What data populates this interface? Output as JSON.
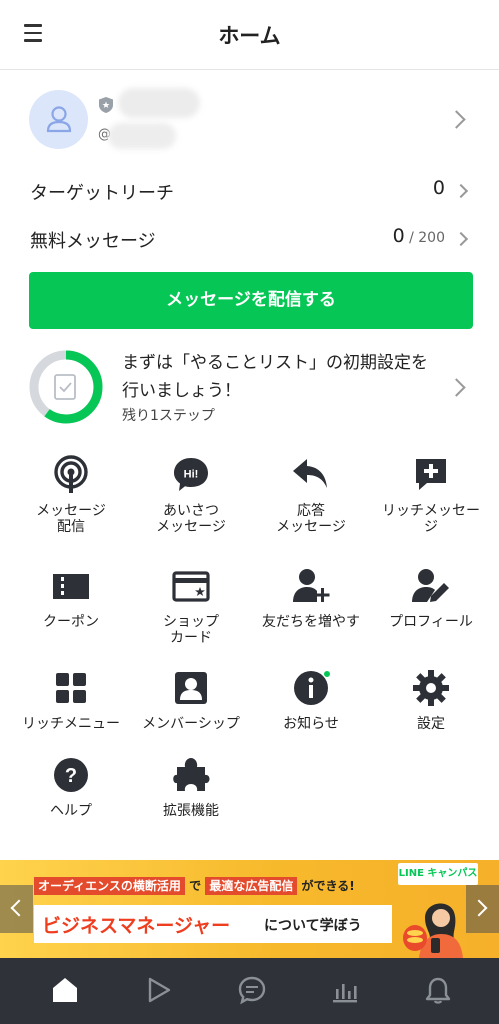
{
  "header": {
    "title": "ホーム",
    "menu_icon": "hamburger-icon"
  },
  "profile": {
    "handle_prefix": "@"
  },
  "stats": [
    {
      "label": "ターゲットリーチ",
      "value": "0",
      "sub": ""
    },
    {
      "label": "無料メッセージ",
      "value": "0",
      "sub": " / 200"
    }
  ],
  "cta": {
    "label": "メッセージを配信する"
  },
  "setup": {
    "title": "まずは「やることリスト」の初期設定を行いましょう！",
    "subtitle": "残り1ステップ",
    "progress": 0.6
  },
  "grid": [
    {
      "label": "メッセージ\n配信",
      "icon": "broadcast-icon"
    },
    {
      "label": "あいさつ\nメッセージ",
      "icon": "greeting-icon"
    },
    {
      "label": "応答\nメッセージ",
      "icon": "reply-icon"
    },
    {
      "label": "リッチメッセー\nジ",
      "icon": "rich-message-icon"
    },
    {
      "label": "クーポン",
      "icon": "coupon-icon"
    },
    {
      "label": "ショップ\nカード",
      "icon": "shop-card-icon"
    },
    {
      "label": "友だちを増やす",
      "icon": "add-friend-icon"
    },
    {
      "label": "プロフィール",
      "icon": "profile-edit-icon"
    },
    {
      "label": "リッチメニュー",
      "icon": "rich-menu-icon"
    },
    {
      "label": "メンバーシップ",
      "icon": "membership-icon"
    },
    {
      "label": "お知らせ",
      "icon": "info-icon"
    },
    {
      "label": "設定",
      "icon": "gear-icon"
    },
    {
      "label": "ヘルプ",
      "icon": "help-icon"
    },
    {
      "label": "拡張機能",
      "icon": "puzzle-icon"
    }
  ],
  "banner": {
    "tag": "LINE キャンパス",
    "line1_a": "オーディエンスの横断活用",
    "line1_b": "で",
    "line1_c": "最適な広告配信",
    "line1_d": "ができる!",
    "big": "ビジネスマネージャー",
    "small": "について学ぼう"
  },
  "colors": {
    "accent": "#06c755",
    "tabbar": "#2f3239",
    "banner": "#f7b92c"
  },
  "tabbar": [
    "home-icon",
    "play-icon",
    "chat-icon",
    "analytics-icon",
    "bell-icon"
  ]
}
